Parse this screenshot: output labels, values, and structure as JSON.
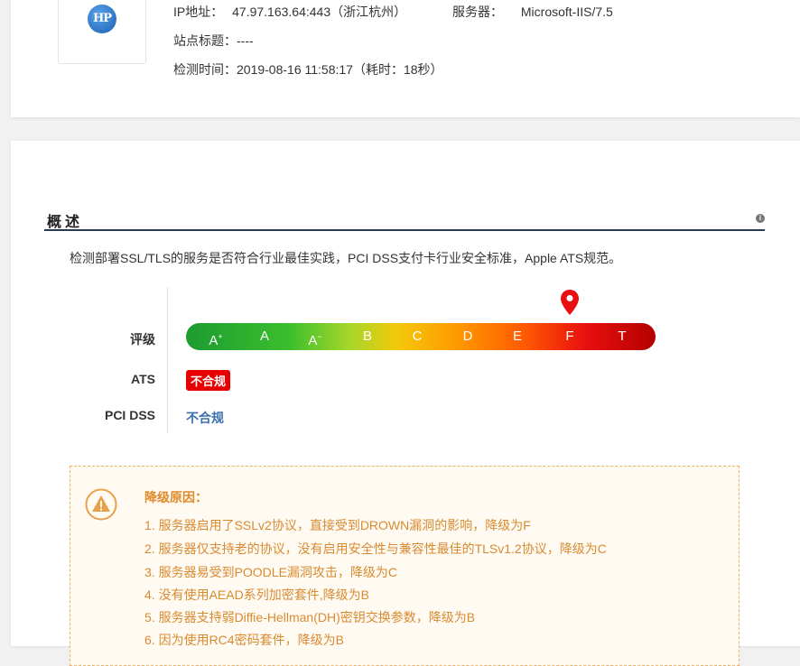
{
  "site": {
    "logo_text": "HP",
    "ip_label": "IP地址：",
    "ip_value": "47.97.163.64:443（浙江杭州）",
    "server_label": "服务器：",
    "server_value": "Microsoft-IIS/7.5",
    "title_label": "站点标题：",
    "title_value": "----",
    "time_label": "检测时间：",
    "time_value": "2019-08-16 11:58:17（耗时：18秒）"
  },
  "overview": {
    "title": "概述",
    "description": "检测部署SSL/TLS的服务是否符合行业最佳实践，PCI DSS支付卡行业安全标准，Apple ATS规范。",
    "rating_label": "评级",
    "grades": [
      "A+",
      "A",
      "A-",
      "B",
      "C",
      "D",
      "E",
      "F",
      "T"
    ],
    "current_grade": "F",
    "ats_label": "ATS",
    "ats_value": "不合规",
    "pci_label": "PCI DSS",
    "pci_value": "不合规"
  },
  "downgrade": {
    "title": "降级原因：",
    "reasons": [
      "1. 服务器启用了SSLv2协议，直接受到DROWN漏洞的影响，降级为F",
      "2. 服务器仅支持老的协议，没有启用安全性与兼容性最佳的TLSv1.2协议，降级为C",
      "3. 服务器易受到POODLE漏洞攻击，降级为C",
      "4. 没有使用AEAD系列加密套件,降级为B",
      "5. 服务器支持弱Diffie-Hellman(DH)密钥交换参数，降级为B",
      "6. 因为使用RC4密码套件，降级为B"
    ]
  },
  "colors": {
    "warn": "#e08a2a",
    "badge": "#e80000",
    "link": "#3a6fb0"
  }
}
